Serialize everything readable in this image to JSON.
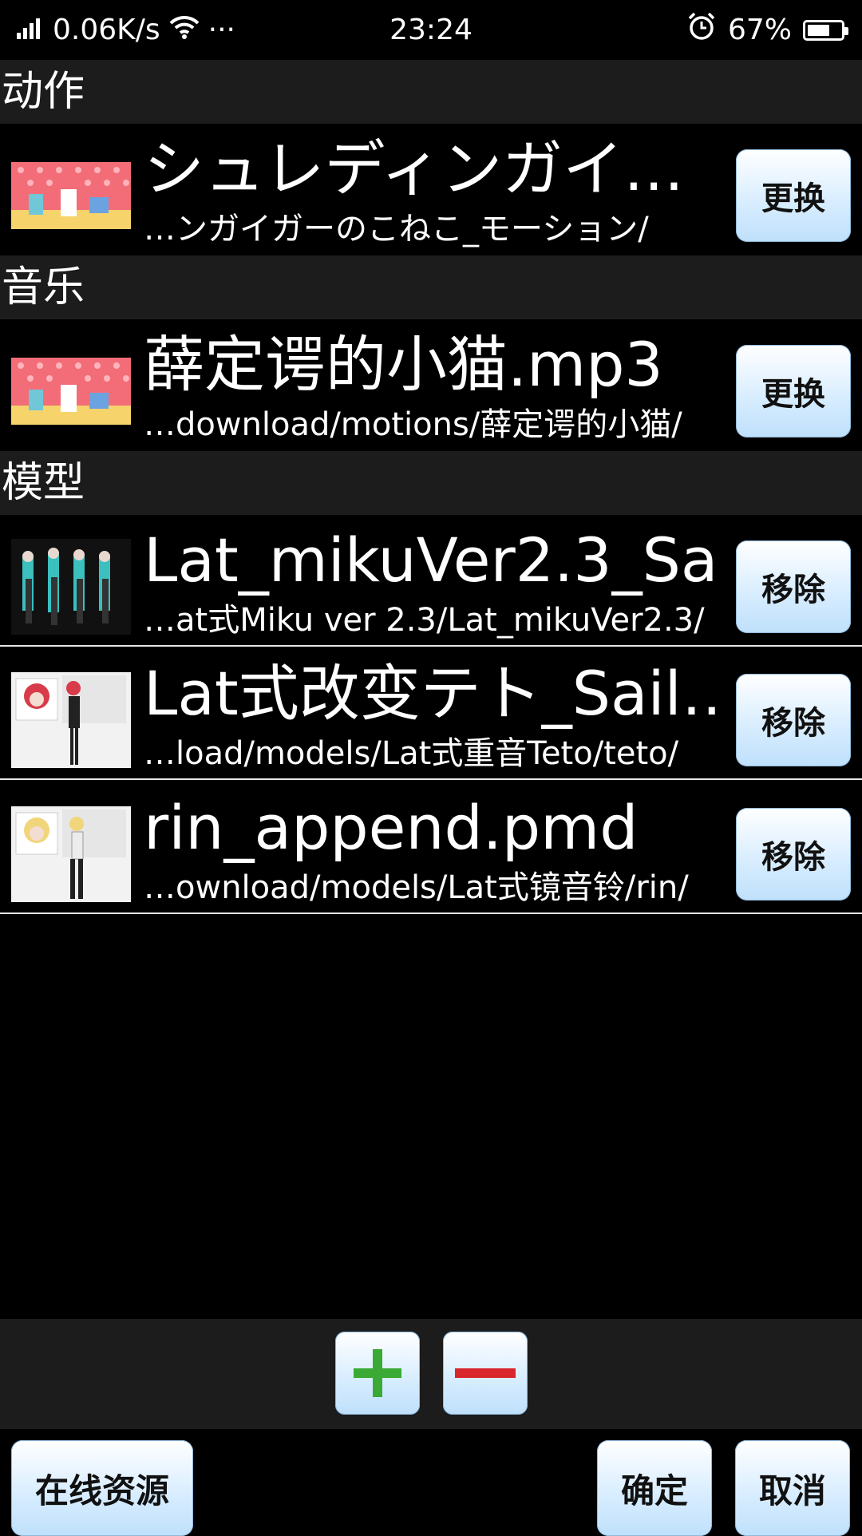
{
  "status_bar": {
    "net_speed": "0.06K/s",
    "more": "···",
    "time": "23:24",
    "battery_percent": "67%",
    "battery_level": 0.67
  },
  "sections": {
    "motion": {
      "header": "动作",
      "title": "シュレディンガイ…",
      "path": "…ンガイガーのこねこ_モーション/",
      "button": "更换"
    },
    "music": {
      "header": "音乐",
      "title": "薛定谔的小猫.mp3",
      "path": "…download/motions/薛定谔的小猫/",
      "button": "更换"
    },
    "models": {
      "header": "模型",
      "items": [
        {
          "title": "Lat_mikuVer2.3_Sa…",
          "path": "…at式Miku ver 2.3/Lat_mikuVer2.3/",
          "button": "移除"
        },
        {
          "title": "Lat式改变テト_Sail…",
          "path": "…load/models/Lat式重音Teto/teto/",
          "button": "移除"
        },
        {
          "title": "rin_append.pmd",
          "path": "…ownload/models/Lat式镜音铃/rin/",
          "button": "移除"
        }
      ]
    }
  },
  "bottom": {
    "online_resources": "在线资源",
    "confirm": "确定",
    "cancel": "取消"
  },
  "colors": {
    "add_icon": "#3aaa35",
    "remove_icon": "#d9262c",
    "button_gradient_bottom": "#bfe0fb"
  }
}
